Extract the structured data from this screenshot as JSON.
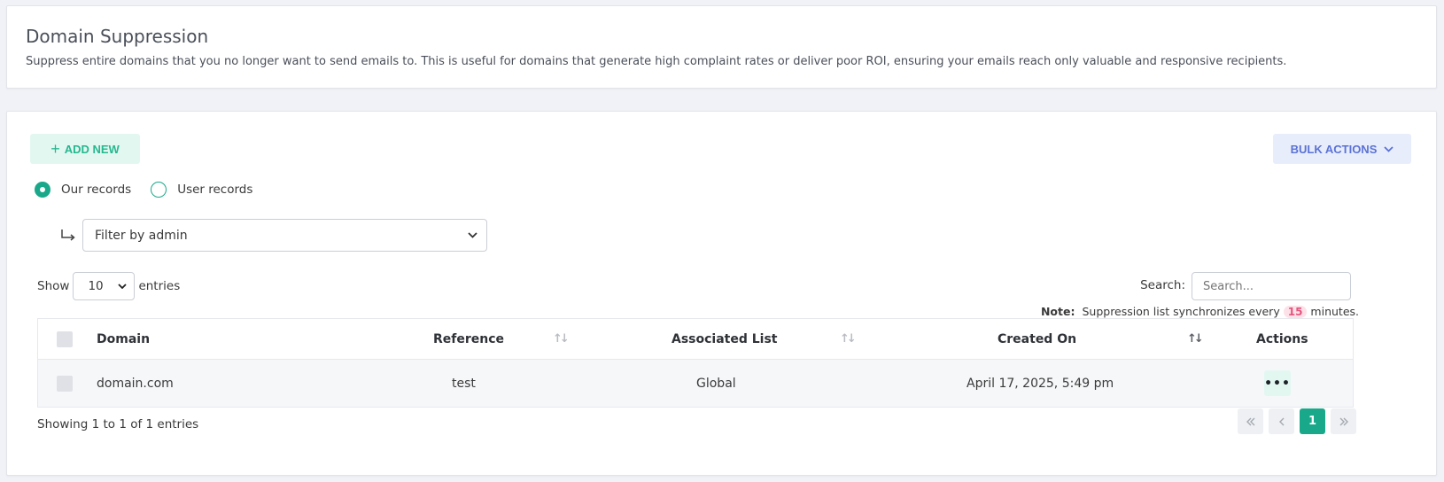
{
  "header": {
    "title": "Domain Suppression",
    "description": "Suppress entire domains that you no longer want to send emails to. This is useful for domains that generate high complaint rates or deliver poor ROI, ensuring your emails reach only valuable and responsive recipients."
  },
  "toolbar": {
    "add_new_label": "ADD NEW",
    "bulk_actions_label": "BULK ACTIONS"
  },
  "records_filter": {
    "options": [
      {
        "label": "Our records",
        "checked": true
      },
      {
        "label": "User records",
        "checked": false
      }
    ],
    "admin_filter_value": "Filter by admin"
  },
  "table_controls": {
    "show_label": "Show",
    "entries_value": "10",
    "entries_label": "entries",
    "search_label": "Search:",
    "search_placeholder": "Search...",
    "note_label": "Note:",
    "note_text_before": "Suppression list synchronizes every",
    "note_minutes": "15",
    "note_text_after": "minutes."
  },
  "table": {
    "columns": [
      "Domain",
      "Reference",
      "Associated List",
      "Created On",
      "Actions"
    ],
    "rows": [
      {
        "domain": "domain.com",
        "reference": "test",
        "associated_list": "Global",
        "created_on": "April 17, 2025, 5:49 pm"
      }
    ]
  },
  "footer": {
    "showing_text": "Showing 1 to 1 of 1 entries",
    "current_page": "1"
  },
  "colors": {
    "accent_green": "#1aa88a",
    "accent_blue": "#5a72d6",
    "badge_pink": "#e35680"
  }
}
